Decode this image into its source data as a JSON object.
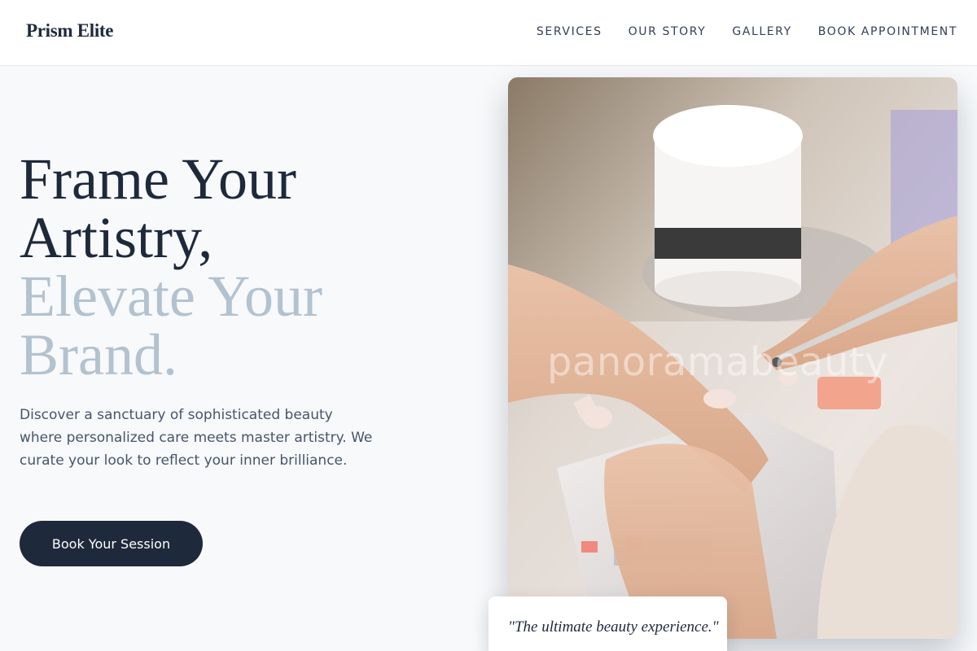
{
  "brand": {
    "name": "Prism Elite"
  },
  "nav": {
    "items": [
      {
        "label": "SERVICES"
      },
      {
        "label": "OUR STORY"
      },
      {
        "label": "GALLERY"
      },
      {
        "label": "BOOK APPOINTMENT"
      }
    ]
  },
  "hero": {
    "title_line1": "Frame Your",
    "title_line2": "Artistry,",
    "title_line3": "Elevate Your",
    "title_line4": "Brand.",
    "description": "Discover a sanctuary of sophisticated beauty where personalized care meets master artistry. We curate your look to reflect your inner brilliance.",
    "cta_label": "Book Your Session"
  },
  "image": {
    "watermark": "panoramabeauty",
    "subject": "nail-technician-manicure-photo"
  },
  "quote": {
    "text": "\"The ultimate beauty experience.\""
  },
  "colors": {
    "primary": "#1e293b",
    "accent_light": "#b2c2cf",
    "background": "#f7f9fb",
    "body_text": "#475569"
  }
}
